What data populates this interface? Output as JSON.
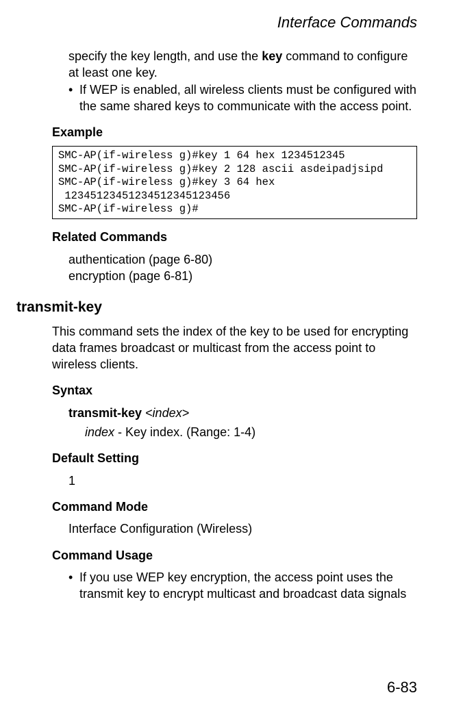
{
  "header": {
    "running": "Interface Commands"
  },
  "intro": {
    "cont_line_pre": "specify the key length, and use the ",
    "cont_line_bold": "key",
    "cont_line_post": " command to configure at least one key.",
    "bullet1": "If WEP is enabled, all wireless clients must be configured with the same shared keys to communicate with the access point."
  },
  "example": {
    "label": "Example",
    "code": "SMC-AP(if-wireless g)#key 1 64 hex 1234512345\nSMC-AP(if-wireless g)#key 2 128 ascii asdeipadjsipd\nSMC-AP(if-wireless g)#key 3 64 hex\n 12345123451234512345123456\nSMC-AP(if-wireless g)#"
  },
  "related": {
    "label": "Related Commands",
    "line1": "authentication (page 6-80)",
    "line2": "encryption (page 6-81)"
  },
  "cmd": {
    "title": "transmit-key",
    "desc": "This command sets the index of the key to be used for encrypting data frames broadcast or multicast from the access point to wireless clients.",
    "syntax_label": "Syntax",
    "syntax_bold": "transmit-key",
    "syntax_arg": " <index>",
    "syntax_def_term": "index",
    "syntax_def_rest": " - Key index. (Range: 1-4)",
    "default_label": "Default Setting",
    "default_value": "1",
    "mode_label": "Command Mode",
    "mode_value": "Interface Configuration (Wireless)",
    "usage_label": "Command Usage",
    "usage_bullet": "If you use WEP key encryption, the access point uses the transmit key to encrypt multicast and broadcast data signals"
  },
  "footer": {
    "page": "6-83"
  }
}
